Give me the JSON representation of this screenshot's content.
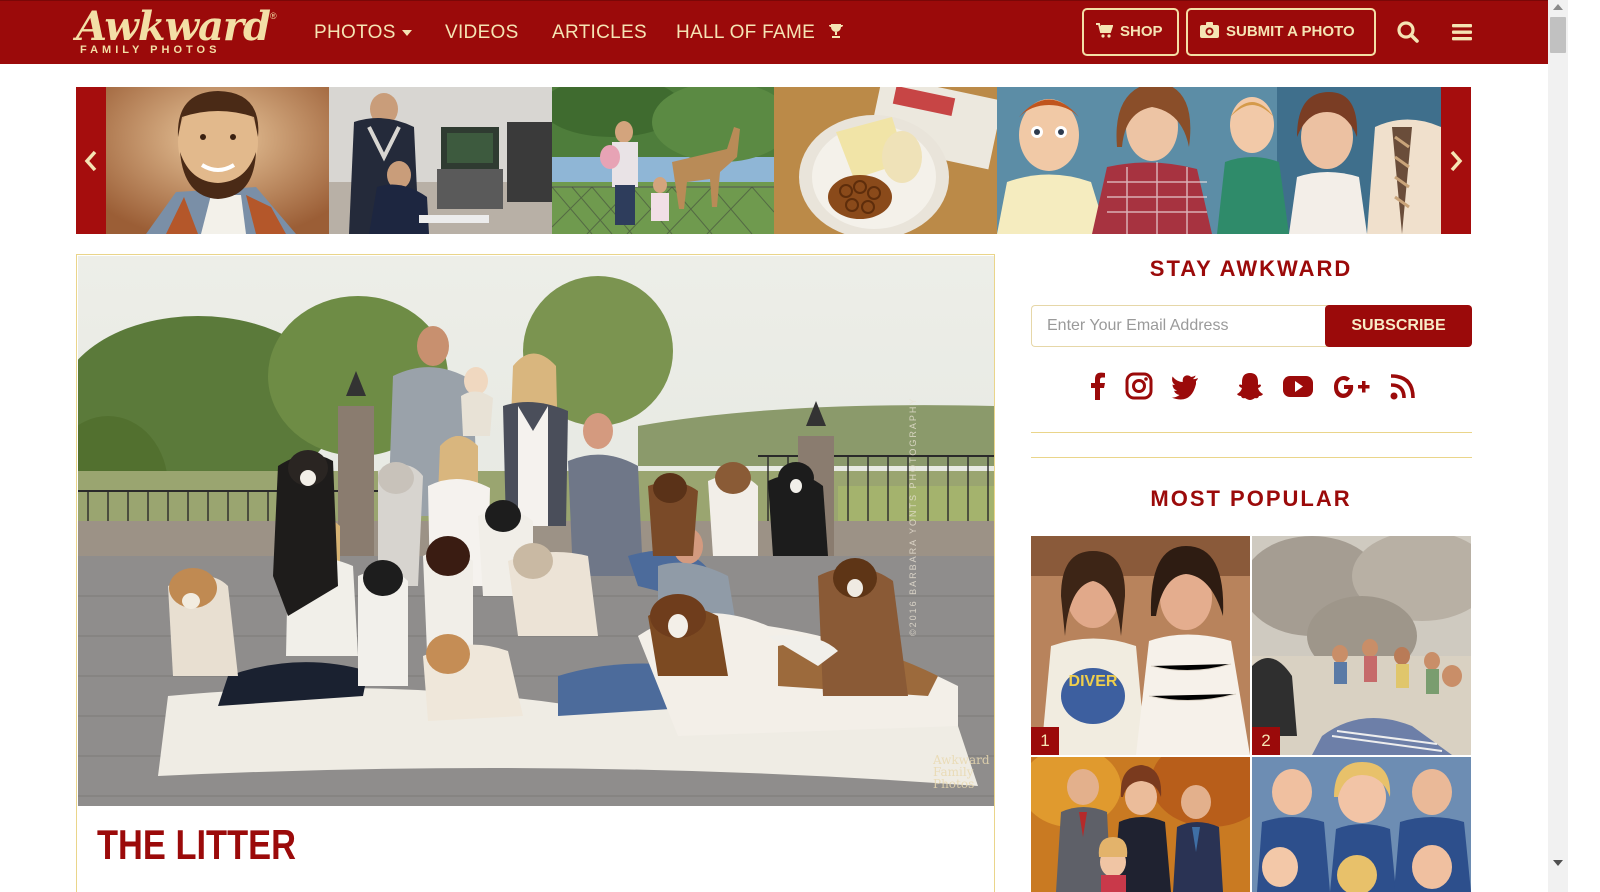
{
  "brand": {
    "name": "Awkward",
    "tagline": "FAMILY PHOTOS",
    "colors": {
      "primary": "#9b0a0a",
      "accent": "#f3dfa6",
      "border": "#ead58a"
    }
  },
  "nav": {
    "links": [
      {
        "label": "PHOTOS",
        "icon": "caret-down-icon"
      },
      {
        "label": "VIDEOS"
      },
      {
        "label": "ARTICLES"
      },
      {
        "label": "HALL OF FAME",
        "icon": "trophy-icon"
      }
    ],
    "shop_label": "SHOP",
    "submit_label": "SUBMIT A PHOTO",
    "search_icon": "search-icon",
    "menu_icon": "hamburger-menu-icon"
  },
  "carousel": {
    "prev_icon": "chevron-left-icon",
    "next_icon": "chevron-right-icon",
    "thumbnails": [
      "bearded-man-portrait",
      "man-at-computer",
      "family-at-zoo-giraffe",
      "snack-plate-pretzels",
      "family-portrait"
    ]
  },
  "post": {
    "title": "THE LITTER",
    "watermark": "Awkward Family Photos",
    "credit": "©2016 BARBARA YONTS PHOTOGRAPHY"
  },
  "sidebar": {
    "stay_heading": "STAY AWKWARD",
    "email_placeholder": "Enter Your Email Address",
    "subscribe_label": "SUBSCRIBE",
    "social_icons": [
      "facebook-icon",
      "instagram-icon",
      "twitter-icon",
      "snapchat-icon",
      "youtube-icon",
      "google-plus-icon",
      "rss-icon"
    ],
    "popular_heading": "MOST POPULAR",
    "popular": [
      {
        "rank": "1"
      },
      {
        "rank": "2"
      },
      {
        "rank": ""
      },
      {
        "rank": ""
      }
    ]
  }
}
